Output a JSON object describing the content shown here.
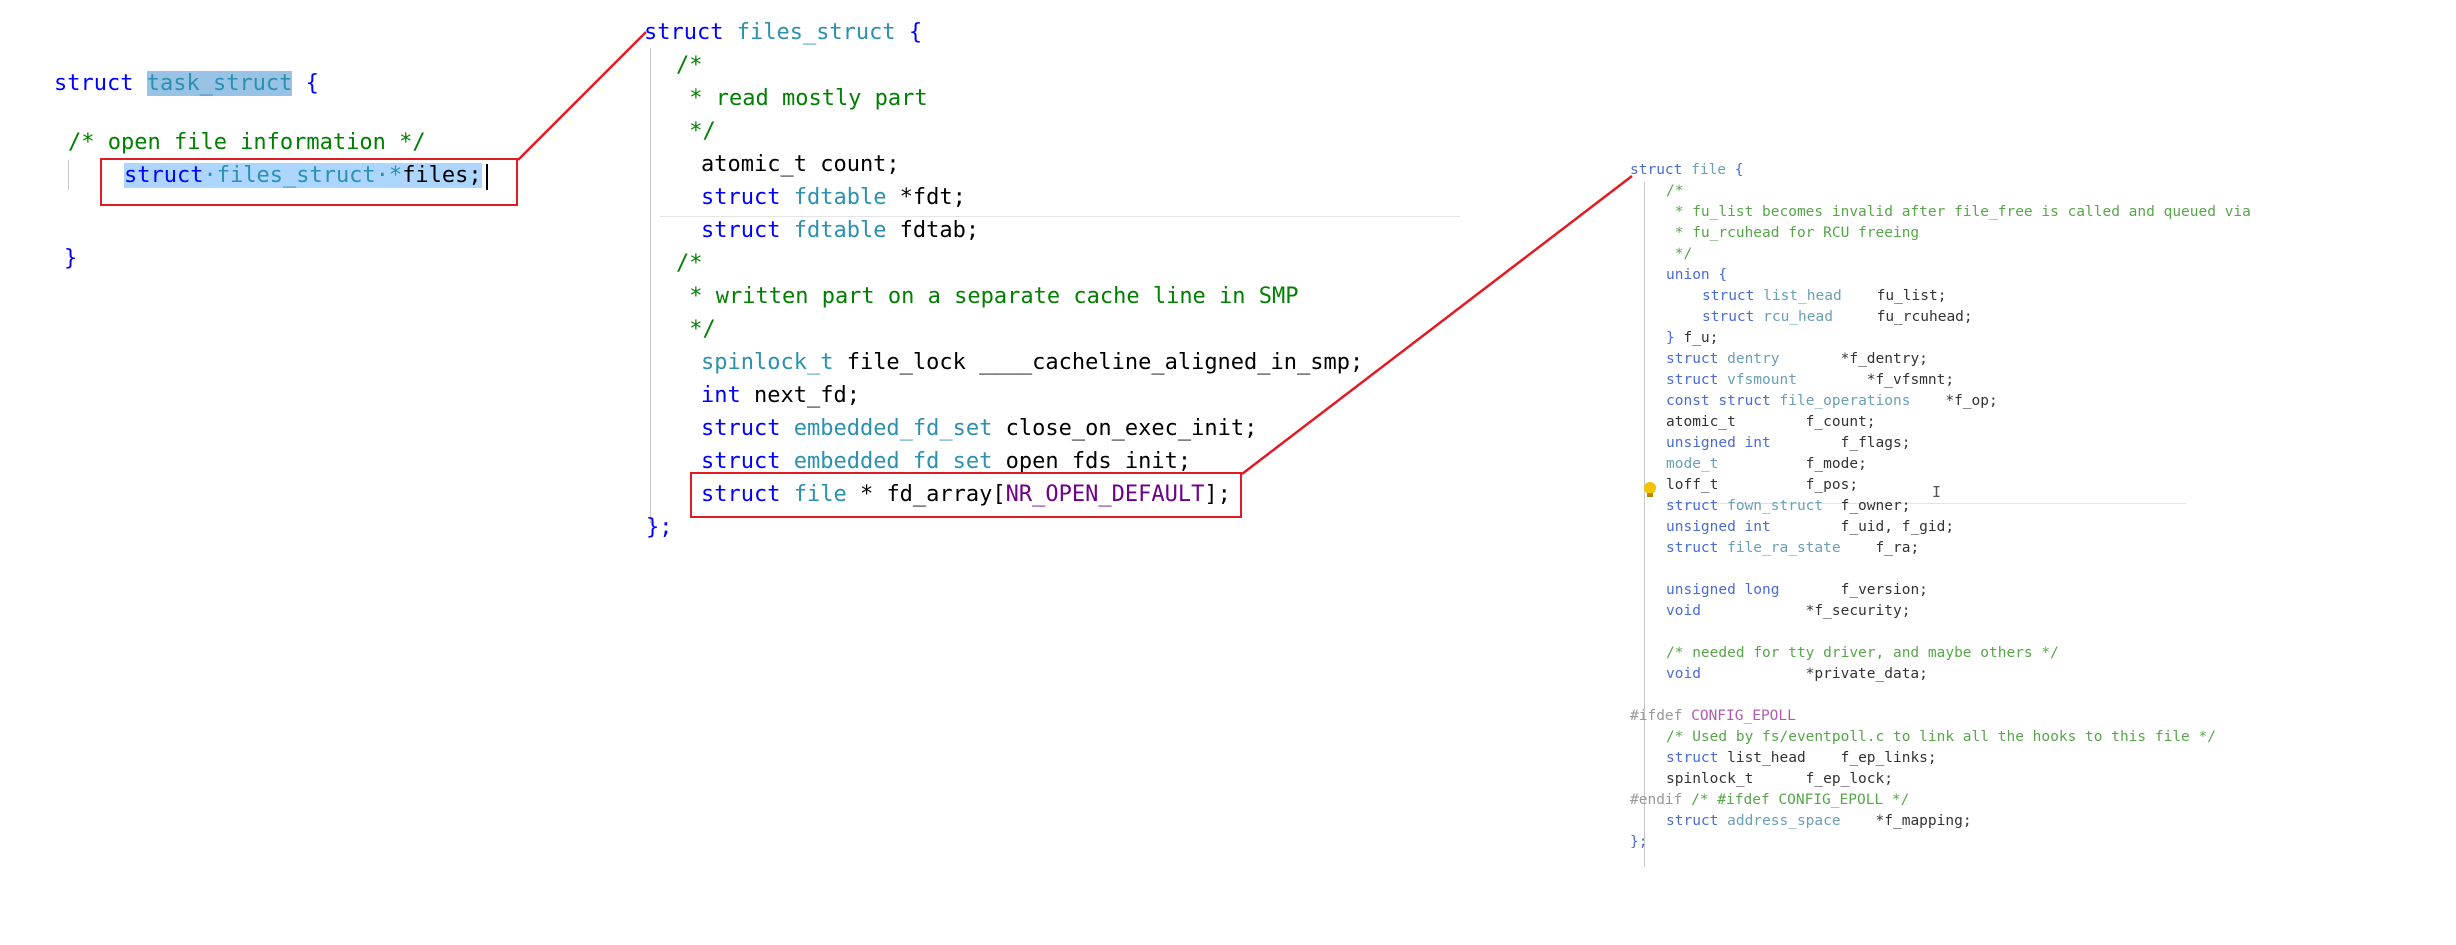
{
  "task_struct_panel": {
    "lines": [
      [
        {
          "t": "struct ",
          "c": "kw"
        },
        {
          "t": "task_struct",
          "c": "type",
          "hl": "strong"
        },
        {
          "t": " {",
          "c": "kw"
        }
      ],
      [
        {
          "t": "/* open file information */",
          "c": "cmt"
        }
      ],
      [
        {
          "t": "struct",
          "c": "kw",
          "hl": "sel"
        },
        {
          "t": "·",
          "c": "type",
          "hl": "sel"
        },
        {
          "t": "files_struct",
          "c": "type",
          "hl": "sel"
        },
        {
          "t": "·*",
          "c": "type",
          "hl": "sel"
        },
        {
          "t": "files;",
          "c": "id",
          "hl": "sel"
        }
      ],
      [
        {
          "t": "}",
          "c": "kw"
        }
      ]
    ]
  },
  "files_struct_panel": {
    "lines": [
      [
        {
          "t": "struct ",
          "c": "kw"
        },
        {
          "t": "files_struct",
          "c": "type"
        },
        {
          "t": " {",
          "c": "kw"
        }
      ],
      [
        {
          "t": "/*",
          "c": "cmt"
        }
      ],
      [
        {
          "t": " * read mostly part",
          "c": "cmt"
        }
      ],
      [
        {
          "t": " */",
          "c": "cmt"
        }
      ],
      [
        {
          "t": "atomic_t count;",
          "c": "id"
        }
      ],
      [
        {
          "t": "struct ",
          "c": "kw"
        },
        {
          "t": "fdtable",
          "c": "type"
        },
        {
          "t": " *fdt;",
          "c": "id"
        }
      ],
      [
        {
          "t": "struct ",
          "c": "kw"
        },
        {
          "t": "fdtable",
          "c": "type"
        },
        {
          "t": " fdtab;",
          "c": "id"
        }
      ],
      [
        {
          "t": "/*",
          "c": "cmt"
        }
      ],
      [
        {
          "t": " * written part on a separate cache line in SMP",
          "c": "cmt"
        }
      ],
      [
        {
          "t": " */",
          "c": "cmt"
        }
      ],
      [
        {
          "t": "spinlock_t",
          "c": "type"
        },
        {
          "t": " file_lock ____cacheline_aligned_in_smp;",
          "c": "id"
        }
      ],
      [
        {
          "t": "int",
          "c": "kw"
        },
        {
          "t": " next_fd;",
          "c": "id"
        }
      ],
      [
        {
          "t": "struct ",
          "c": "kw"
        },
        {
          "t": "embedded_fd_set",
          "c": "type"
        },
        {
          "t": " close_on_exec_init;",
          "c": "id"
        }
      ],
      [
        {
          "t": "struct ",
          "c": "kw"
        },
        {
          "t": "embedded_fd_set",
          "c": "type"
        },
        {
          "t": " open_fds_init;",
          "c": "id"
        }
      ],
      [
        {
          "t": "struct ",
          "c": "kw"
        },
        {
          "t": "file",
          "c": "type"
        },
        {
          "t": " * fd_array[",
          "c": "id"
        },
        {
          "t": "NR_OPEN_DEFAULT",
          "c": "macro"
        },
        {
          "t": "];",
          "c": "id"
        }
      ],
      [
        {
          "t": "};",
          "c": "kw"
        }
      ]
    ]
  },
  "file_panel": {
    "lines": [
      [
        {
          "t": "struct ",
          "c": "kw"
        },
        {
          "t": "file",
          "c": "type"
        },
        {
          "t": " {",
          "c": "kw"
        }
      ],
      [
        {
          "t": "/*",
          "c": "cmt"
        }
      ],
      [
        {
          "t": " * fu_list becomes invalid after file_free is called and queued via",
          "c": "cmt"
        }
      ],
      [
        {
          "t": " * fu_rcuhead for RCU freeing",
          "c": "cmt"
        }
      ],
      [
        {
          "t": " */",
          "c": "cmt"
        }
      ],
      [
        {
          "t": "union {",
          "c": "kw"
        }
      ],
      [
        {
          "t": "struct ",
          "c": "kw"
        },
        {
          "t": "list_head",
          "c": "type"
        },
        {
          "t": "    fu_list;",
          "c": "id"
        }
      ],
      [
        {
          "t": "struct ",
          "c": "kw"
        },
        {
          "t": "rcu_head",
          "c": "type"
        },
        {
          "t": "     fu_rcuhead;",
          "c": "id"
        }
      ],
      [
        {
          "t": "} ",
          "c": "kw"
        },
        {
          "t": "f_u;",
          "c": "id"
        }
      ],
      [
        {
          "t": "struct ",
          "c": "kw"
        },
        {
          "t": "dentry",
          "c": "type"
        },
        {
          "t": "       *f_dentry;",
          "c": "id"
        }
      ],
      [
        {
          "t": "struct ",
          "c": "kw"
        },
        {
          "t": "vfsmount",
          "c": "type"
        },
        {
          "t": "        *f_vfsmnt;",
          "c": "id"
        }
      ],
      [
        {
          "t": "const struct ",
          "c": "kw"
        },
        {
          "t": "file_operations",
          "c": "type"
        },
        {
          "t": "    *f_op;",
          "c": "id"
        }
      ],
      [
        {
          "t": "atomic_t        f_count;",
          "c": "id"
        }
      ],
      [
        {
          "t": "unsigned int",
          "c": "kw"
        },
        {
          "t": "        f_flags;",
          "c": "id"
        }
      ],
      [
        {
          "t": "mode_t",
          "c": "type"
        },
        {
          "t": "          f_mode;",
          "c": "id"
        }
      ],
      [
        {
          "t": "loff_t          f_pos;",
          "c": "id"
        }
      ],
      [
        {
          "t": "struct ",
          "c": "kw"
        },
        {
          "t": "fown_struct",
          "c": "type"
        },
        {
          "t": "  f_owner;",
          "c": "id"
        }
      ],
      [
        {
          "t": "unsigned int",
          "c": "kw"
        },
        {
          "t": "        f_uid, f_gid;",
          "c": "id"
        }
      ],
      [
        {
          "t": "struct ",
          "c": "kw"
        },
        {
          "t": "file_ra_state",
          "c": "type"
        },
        {
          "t": "    f_ra;",
          "c": "id"
        }
      ],
      [],
      [
        {
          "t": "unsigned long",
          "c": "kw"
        },
        {
          "t": "       f_version;",
          "c": "id"
        }
      ],
      [
        {
          "t": "void",
          "c": "kw"
        },
        {
          "t": "            *f_security;",
          "c": "id"
        }
      ],
      [],
      [
        {
          "t": "/* needed for tty driver, and maybe others */",
          "c": "cmt"
        }
      ],
      [
        {
          "t": "void",
          "c": "kw"
        },
        {
          "t": "            *private_data;",
          "c": "id"
        }
      ],
      [],
      [
        {
          "t": "#ifdef ",
          "c": "pp"
        },
        {
          "t": "CONFIG_EPOLL",
          "c": "macro"
        }
      ],
      [
        {
          "t": "/* Used by fs/eventpoll.c to link all the hooks to this file */",
          "c": "cmt"
        }
      ],
      [
        {
          "t": "struct ",
          "c": "kw"
        },
        {
          "t": "list_head",
          "c": "id"
        },
        {
          "t": "    f_ep_links;",
          "c": "id"
        }
      ],
      [
        {
          "t": "spinlock_t      f_ep_lock;",
          "c": "id"
        }
      ],
      [
        {
          "t": "#endif ",
          "c": "pp"
        },
        {
          "t": "/* #ifdef CONFIG_EPOLL */",
          "c": "cmt"
        }
      ],
      [
        {
          "t": "struct ",
          "c": "kw"
        },
        {
          "t": "address_space",
          "c": "type"
        },
        {
          "t": "    *f_mapping;",
          "c": "id"
        }
      ],
      [
        {
          "t": "};",
          "c": "kw"
        }
      ]
    ]
  },
  "colors": {
    "keyword": "#0000ff",
    "type": "#2b91af",
    "comment": "#008000",
    "macro": "#6f008a",
    "callout": "#e01b24",
    "selection": "#add6ff"
  }
}
